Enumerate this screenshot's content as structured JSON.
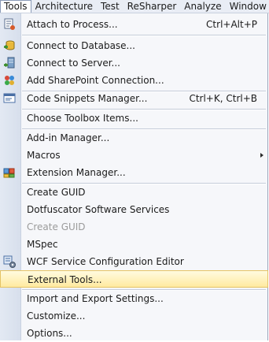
{
  "menubar": {
    "items": [
      "Tools",
      "Architecture",
      "Test",
      "ReSharper",
      "Analyze",
      "Window"
    ]
  },
  "menu": {
    "items": [
      {
        "label": "Attach to Process...",
        "shortcut": "Ctrl+Alt+P",
        "icon": "attach-process-icon"
      },
      {
        "label": "Connect to Database...",
        "icon": "connect-database-icon"
      },
      {
        "label": "Connect to Server...",
        "icon": "connect-server-icon"
      },
      {
        "label": "Add SharePoint Connection...",
        "icon": "sharepoint-connection-icon"
      },
      {
        "label": "Code Snippets Manager...",
        "shortcut": "Ctrl+K, Ctrl+B",
        "icon": "code-snippets-icon"
      },
      {
        "label": "Choose Toolbox Items..."
      },
      {
        "label": "Add-in Manager..."
      },
      {
        "label": "Macros"
      },
      {
        "label": "Extension Manager...",
        "icon": "extension-manager-icon"
      },
      {
        "label": "Create GUID"
      },
      {
        "label": "Dotfuscator Software Services"
      },
      {
        "label": "Create GUID"
      },
      {
        "label": "MSpec"
      },
      {
        "label": "WCF Service Configuration Editor",
        "icon": "wcf-config-editor-icon"
      },
      {
        "label": "External Tools..."
      },
      {
        "label": "Import and Export Settings..."
      },
      {
        "label": "Customize..."
      },
      {
        "label": "Options..."
      }
    ]
  },
  "colors": {
    "highlight": "#ffeaa0",
    "disabled_text": "#9b9b9b"
  }
}
